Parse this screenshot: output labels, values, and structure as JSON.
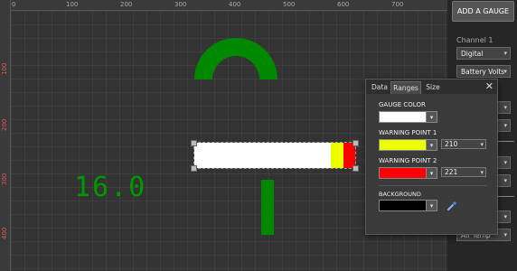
{
  "ruler": {
    "top_ticks": [
      "0",
      "100",
      "200",
      "300",
      "400",
      "500",
      "600",
      "700"
    ],
    "left_ticks": [
      "100",
      "200",
      "300",
      "400"
    ]
  },
  "digital_value": "16.0",
  "sidebar": {
    "add_gauge_label": "ADD A GAUGE",
    "channel_label": "Channel 1",
    "selects": [
      "Digital",
      "Battery Volts",
      "",
      "",
      "",
      "",
      "",
      "",
      "Air Temp"
    ]
  },
  "panel": {
    "tabs": [
      "Data",
      "Ranges",
      "Size"
    ],
    "active_tab": "Ranges",
    "close_glyph": "✕",
    "gauge_color_label": "GAUGE COLOR",
    "gauge_color": "#ffffff",
    "warning1_label": "WARNING POINT 1",
    "warning1_color": "#eeff00",
    "warning1_value": "210",
    "warning2_label": "WARNING POINT 2",
    "warning2_color": "#ff0000",
    "warning2_value": "221",
    "background_label": "BACKGROUND",
    "background_color": "#000000"
  },
  "colors": {
    "gauge_green": "#008800",
    "digital_green": "#009900"
  },
  "icons": {
    "close": "close-icon",
    "dropper": "eyedropper-icon",
    "dropdown": "chevron-down-icon"
  }
}
